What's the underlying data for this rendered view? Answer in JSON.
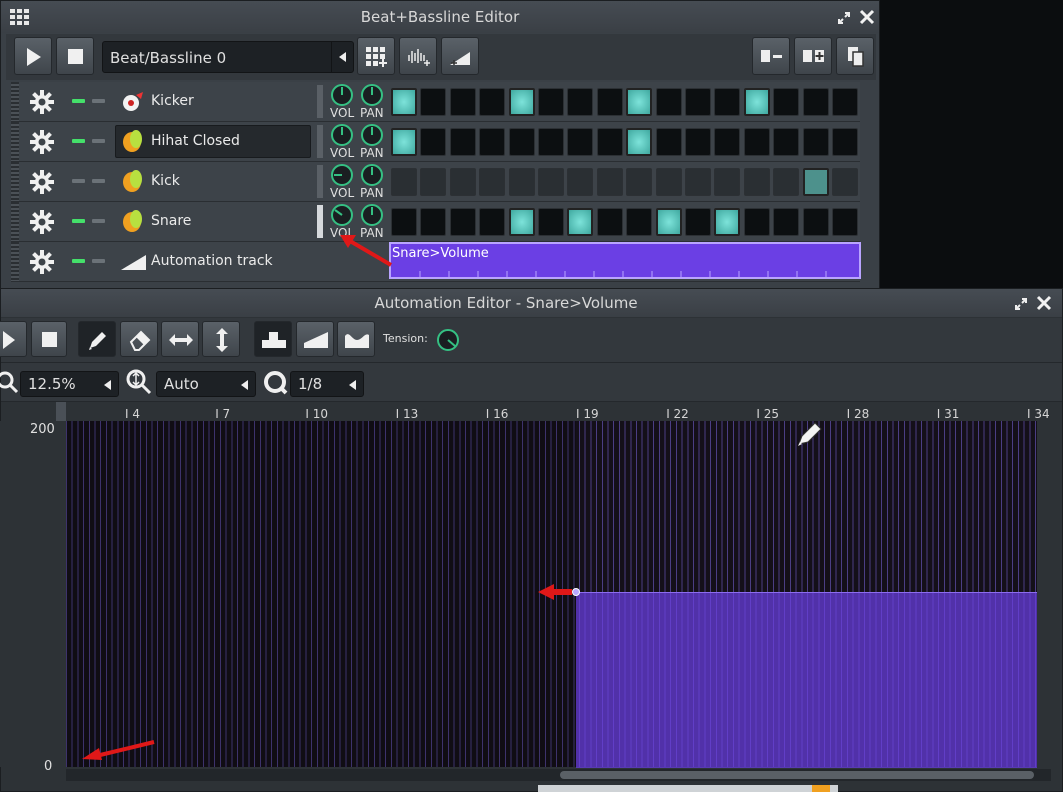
{
  "bb_editor": {
    "title": "Beat+Bassline Editor",
    "selector_value": "Beat/Bassline 0",
    "tracks": [
      {
        "name": "Kicker",
        "steps": [
          1,
          0,
          0,
          0,
          1,
          0,
          0,
          0,
          1,
          0,
          0,
          0,
          1,
          0,
          0,
          0
        ],
        "muted_steps": false
      },
      {
        "name": "Hihat Closed",
        "steps": [
          1,
          0,
          0,
          0,
          0,
          0,
          0,
          0,
          1,
          0,
          0,
          0,
          0,
          0,
          0,
          0
        ],
        "muted_steps": false
      },
      {
        "name": "Kick",
        "steps": [
          0,
          0,
          0,
          0,
          0,
          0,
          0,
          0,
          0,
          0,
          0,
          0,
          0,
          0,
          1,
          0
        ],
        "muted_steps": true
      },
      {
        "name": "Snare",
        "steps": [
          0,
          0,
          0,
          0,
          1,
          0,
          1,
          0,
          0,
          1,
          0,
          1,
          0,
          0,
          0,
          0
        ],
        "muted_steps": false
      }
    ],
    "automation_track": {
      "name": "Automation track",
      "pattern_label": "Snare>Volume"
    },
    "knob_labels": {
      "vol": "VOL",
      "pan": "PAN"
    }
  },
  "automation_editor": {
    "title": "Automation Editor - Snare>Volume",
    "tension_label": "Tension:",
    "zoom_x": "12.5%",
    "zoom_y": "Auto",
    "quantize": "1/8",
    "ruler": [
      "4",
      "7",
      "10",
      "13",
      "16",
      "19",
      "22",
      "25",
      "28",
      "31",
      "34"
    ],
    "y_max": "200",
    "y_min": "0",
    "automation_level": 0.5
  },
  "colors": {
    "accent_teal": "#5fd0c7",
    "automation_purple": "#6a3fe0",
    "knob_green": "#35c083",
    "annotation_red": "#e01818"
  }
}
